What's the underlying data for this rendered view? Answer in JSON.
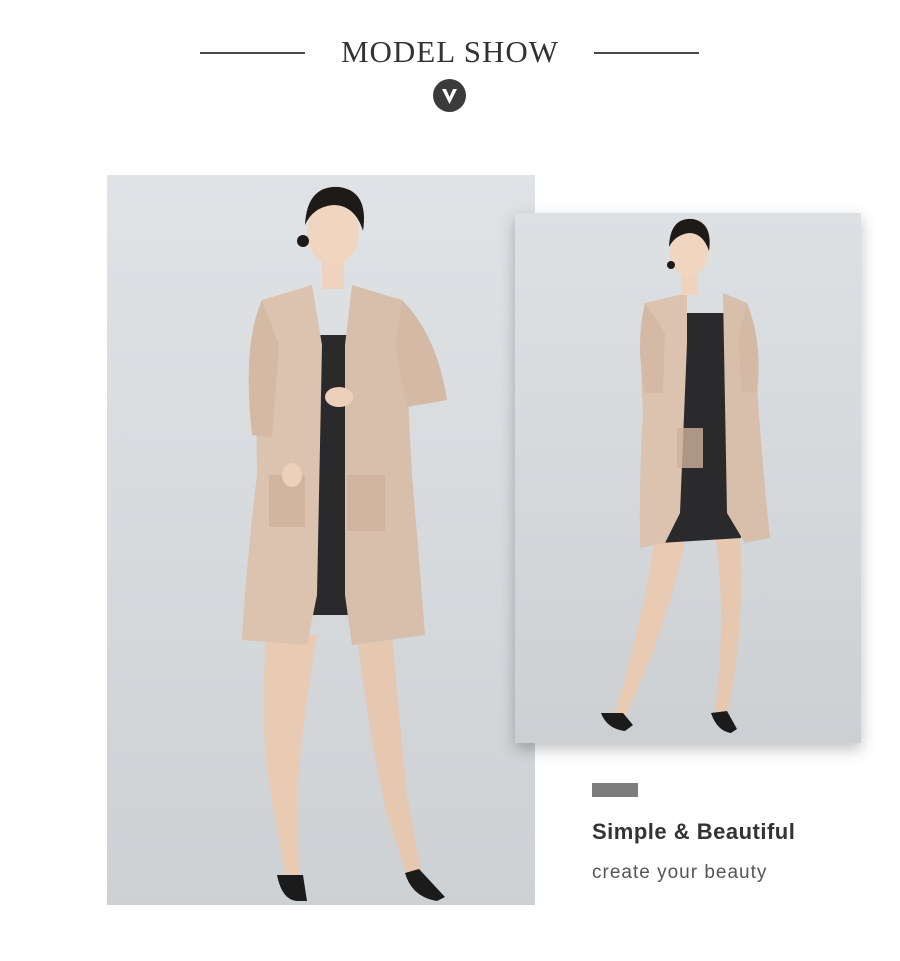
{
  "header": {
    "title": "MODEL SHOW",
    "badge_icon": "chevron-v-icon"
  },
  "photos": {
    "main": {
      "subject": "photo"
    },
    "secondary": {
      "subject": "photo"
    }
  },
  "caption": {
    "title": "Simple & Beautiful",
    "subtitle": "create your beauty"
  },
  "colors": {
    "heading": "#333333",
    "badge": "#3b3b3b",
    "accent_bar": "#7d7d7d",
    "cardigan": "#dcc3b0",
    "dress": "#2a2a2c",
    "background": "#ffffff"
  }
}
